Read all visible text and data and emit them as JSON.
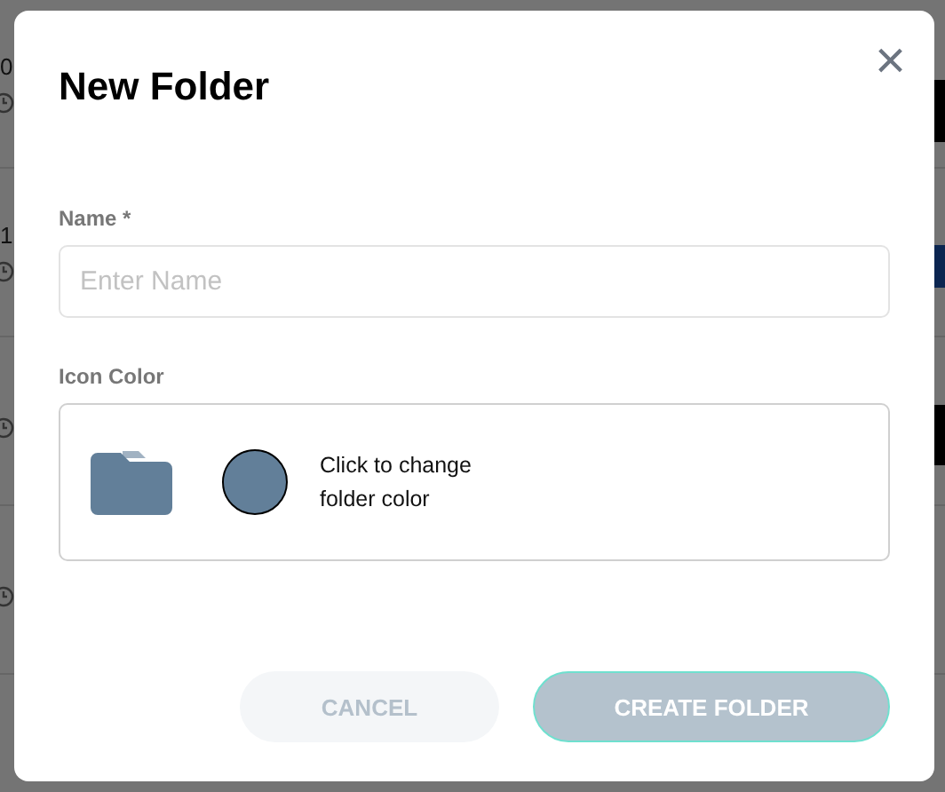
{
  "background": {
    "rows": [
      {
        "label": "0"
      },
      {
        "label": "1"
      },
      {},
      {}
    ]
  },
  "dialog": {
    "title": "New Folder",
    "close": "×",
    "name_field": {
      "label": "Name *",
      "placeholder": "Enter Name"
    },
    "icon_color": {
      "label": "Icon Color",
      "color": "#627f99",
      "hint": "Click to change folder color"
    },
    "buttons": [
      {
        "label": "CANCEL",
        "kind": "secondary",
        "disabled": false
      },
      {
        "label": "CREATE FOLDER",
        "kind": "primary",
        "disabled": true
      }
    ]
  }
}
